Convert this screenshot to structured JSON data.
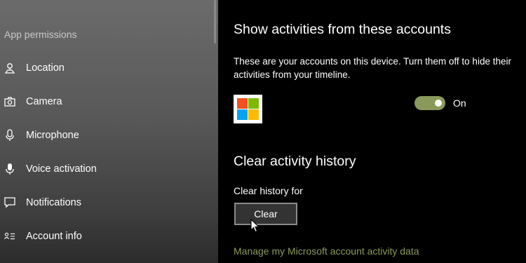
{
  "sidebar": {
    "section_label": "App permissions",
    "items": [
      {
        "label": "Location",
        "icon": "location-icon"
      },
      {
        "label": "Camera",
        "icon": "camera-icon"
      },
      {
        "label": "Microphone",
        "icon": "microphone-icon"
      },
      {
        "label": "Voice activation",
        "icon": "voice-activation-icon"
      },
      {
        "label": "Notifications",
        "icon": "notifications-icon"
      },
      {
        "label": "Account info",
        "icon": "account-info-icon"
      }
    ]
  },
  "main": {
    "accounts_heading": "Show activities from these accounts",
    "accounts_description": "These are your accounts on this device. Turn them off to hide their activities from your timeline.",
    "account_toggle": {
      "state_label": "On",
      "on": true
    },
    "clear_heading": "Clear activity history",
    "clear_subheading": "Clear history for",
    "clear_button": "Clear",
    "manage_link": "Manage my Microsoft account activity data"
  },
  "colors": {
    "accent": "#8a9a5b",
    "ms_red": "#f25022",
    "ms_green": "#7fba00",
    "ms_blue": "#00a4ef",
    "ms_yellow": "#ffb900"
  }
}
